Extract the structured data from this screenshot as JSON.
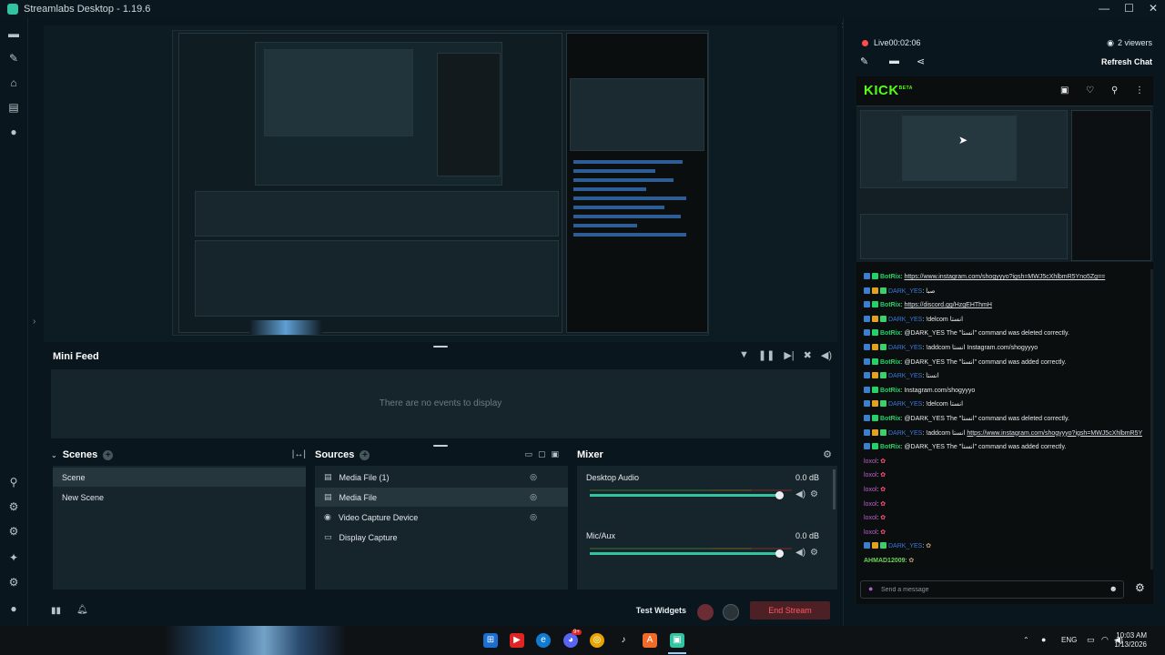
{
  "window": {
    "title": "Streamlabs Desktop - 1.19.6",
    "minimize": "—",
    "maximize": "☐",
    "close": "✕"
  },
  "minifeed": {
    "title": "Mini Feed",
    "empty_text": "There are no events to display"
  },
  "scenes": {
    "title": "Scenes",
    "items": [
      "Scene",
      "New Scene"
    ],
    "selected": 0
  },
  "sources": {
    "title": "Sources",
    "items": [
      {
        "label": "Media File (1)",
        "icon": "file-icon"
      },
      {
        "label": "Media File",
        "icon": "file-icon"
      },
      {
        "label": "Video Capture Device",
        "icon": "webcam-icon"
      },
      {
        "label": "Display Capture",
        "icon": "monitor-icon"
      }
    ],
    "selected": 1
  },
  "mixer": {
    "title": "Mixer",
    "channels": [
      {
        "name": "Desktop Audio",
        "db": "0.0 dB",
        "level": 1.0
      },
      {
        "name": "Mic/Aux",
        "db": "0.0 dB",
        "level": 1.0
      }
    ]
  },
  "bottombar": {
    "test_widgets": "Test Widgets",
    "end_stream": "End Stream"
  },
  "chatpane": {
    "live_label": "Live",
    "live_time": "00:02:06",
    "viewers": "2 viewers",
    "refresh_chat": "Refresh Chat",
    "kick_logo": "KICK",
    "kick_beta": "BETA",
    "send_placeholder": "Send a message"
  },
  "chat": [
    {
      "user": "BotRix",
      "kind": "bot",
      "text": ": ",
      "link": "https://www.instagram.com/shogyyyo?igsh=MWJ5cXhlbmR5Yno5Zg=="
    },
    {
      "user": "DARK_YES",
      "kind": "dark",
      "text": ": صبا",
      "link": ""
    },
    {
      "user": "BotRix",
      "kind": "bot",
      "text": ": ",
      "link": "https://discord.gg/HzgEHThmH"
    },
    {
      "user": "DARK_YES",
      "kind": "dark",
      "text": ": !delcom انستا",
      "link": ""
    },
    {
      "user": "BotRix",
      "kind": "bot",
      "text": ": @DARK_YES The \"انستا\" command was deleted correctly.",
      "link": ""
    },
    {
      "user": "DARK_YES",
      "kind": "dark",
      "text": ": !addcom انستا Instagram.com/shogyyyo",
      "link": ""
    },
    {
      "user": "BotRix",
      "kind": "bot",
      "text": ": @DARK_YES The \"انستا\" command was added correctly.",
      "link": ""
    },
    {
      "user": "DARK_YES",
      "kind": "dark",
      "text": ": انستا",
      "link": ""
    },
    {
      "user": "BotRix",
      "kind": "bot",
      "text": ": Instagram.com/shogyyyo",
      "link": ""
    },
    {
      "user": "DARK_YES",
      "kind": "dark",
      "text": ": !delcom انستا",
      "link": ""
    },
    {
      "user": "BotRix",
      "kind": "bot",
      "text": ": @DARK_YES The \"انستا\" command was deleted correctly.",
      "link": ""
    },
    {
      "user": "DARK_YES",
      "kind": "dark",
      "text": ": !addcom انستا ",
      "link": "https://www.instagram.com/shogyyyo?igsh=MWJ5cXhlbmR5Yno5Zg=="
    },
    {
      "user": "BotRix",
      "kind": "bot",
      "text": ": @DARK_YES The \"انستا\" command was added correctly.",
      "link": ""
    },
    {
      "user": "loxol",
      "kind": "loxo",
      "text": ":",
      "link": ""
    },
    {
      "user": "loxol",
      "kind": "loxo",
      "text": ":",
      "link": ""
    },
    {
      "user": "loxol",
      "kind": "loxo",
      "text": ":",
      "link": ""
    },
    {
      "user": "loxol",
      "kind": "loxo",
      "text": ":",
      "link": ""
    },
    {
      "user": "loxol",
      "kind": "loxo",
      "text": ":",
      "link": ""
    },
    {
      "user": "loxol",
      "kind": "loxo",
      "text": ":",
      "link": ""
    },
    {
      "user": "DARK_YES",
      "kind": "dark",
      "text": ":",
      "link": ""
    },
    {
      "user": "AHMAD12009",
      "kind": "ahmad",
      "text": ":",
      "link": ""
    }
  ],
  "taskbar": {
    "apps": [
      "windows-start",
      "youtube",
      "edge",
      "discord",
      "chrome",
      "tiktok",
      "app-a",
      "streamlabs"
    ],
    "discord_badge": "9+",
    "tray_lang": "ENG",
    "time": "10:03 AM",
    "date": "1/13/2026"
  },
  "colors": {
    "accent": "#31c3a2",
    "end_stream": "#ff5a5f",
    "kick_green": "#53fc18",
    "live_red": "#ff4b4b"
  }
}
